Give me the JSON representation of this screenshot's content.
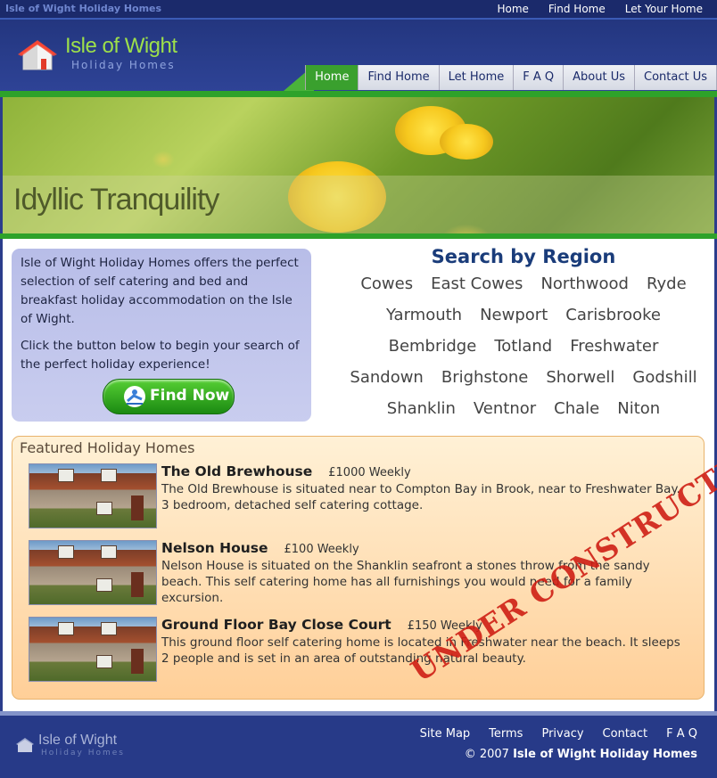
{
  "site": {
    "name": "Isle of Wight Holiday Homes"
  },
  "toplinks": [
    "Home",
    "Find Home",
    "Let Your Home"
  ],
  "logo": {
    "title": "Isle of Wight",
    "subtitle": "Holiday Homes"
  },
  "nav": [
    {
      "label": "Home",
      "active": true
    },
    {
      "label": "Find Home"
    },
    {
      "label": "Let Home"
    },
    {
      "label": "F A Q"
    },
    {
      "label": "About Us"
    },
    {
      "label": "Contact Us"
    }
  ],
  "hero": {
    "tagline": "Idyllic Tranquility"
  },
  "intro": {
    "p1": "Isle of Wight Holiday Homes offers the perfect selection of self catering and bed and breakfast holiday accommodation on the Isle of Wight.",
    "p2": "Click the button below to begin your search of the perfect holiday experience!",
    "button": "Find Now"
  },
  "regions": {
    "title": "Search by Region",
    "rows": [
      [
        "Cowes",
        "East Cowes",
        "Northwood",
        "Ryde"
      ],
      [
        "Yarmouth",
        "Newport",
        "Carisbrooke"
      ],
      [
        "Bembridge",
        "Totland",
        "Freshwater"
      ],
      [
        "Sandown",
        "Brighstone",
        "Shorwell",
        "Godshill"
      ],
      [
        "Shanklin",
        "Ventnor",
        "Chale",
        "Niton"
      ]
    ]
  },
  "featured": {
    "title": "Featured Holiday Homes",
    "listings": [
      {
        "title": "The Old Brewhouse",
        "price": "£1000 Weekly",
        "desc": "The Old Brewhouse is situated near to Compton Bay in Brook, near to Freshwater Bay. 3 bedroom, detached self catering cottage."
      },
      {
        "title": "Nelson House",
        "price": "£100 Weekly",
        "desc": "Nelson House is situated on the Shanklin seafront a stones throw from the sandy beach. This self catering home has all furnishings you would need for a family excursion."
      },
      {
        "title": "Ground Floor Bay Close Court",
        "price": "£150 Weekly",
        "desc": "This ground floor self catering home is located in Freshwater near the beach. It sleeps 2 people and is set in an area of outstanding natural beauty."
      }
    ],
    "stamp": "UNDER CONSTRUCTION"
  },
  "footer": {
    "links": [
      "Site Map",
      "Terms",
      "Privacy",
      "Contact",
      "F A Q"
    ],
    "copyright_prefix": "© 2007",
    "copyright_name": "Isle of Wight Holiday Homes"
  },
  "colors": {
    "brand_blue": "#2b3d8c",
    "accent_green": "#2ea22a",
    "stamp_red": "#ce1e14"
  }
}
